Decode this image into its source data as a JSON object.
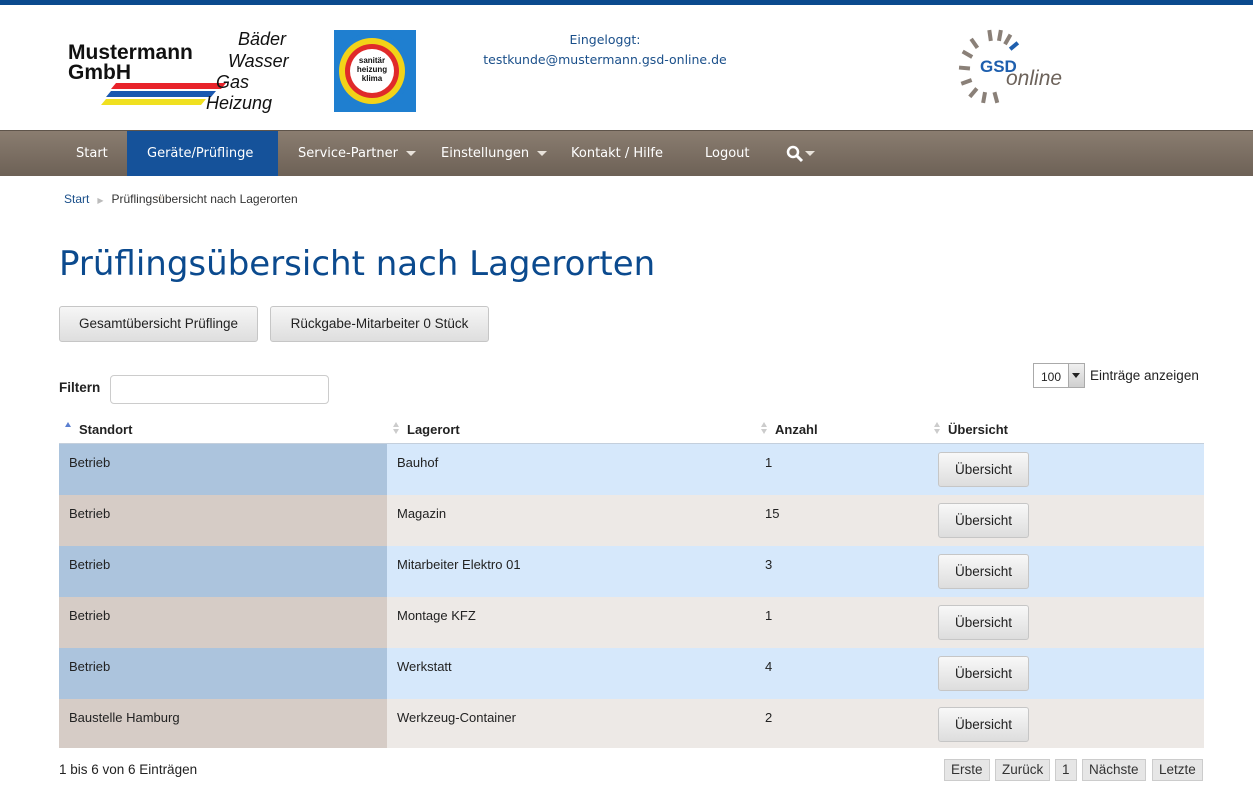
{
  "header": {
    "logo": {
      "line1": "Mustermann",
      "line2": "GmbH",
      "trades": [
        "Bäder",
        "Wasser",
        "Gas",
        "Heizung"
      ]
    },
    "badge": [
      "sanitär",
      "heizung",
      "klima"
    ],
    "login_label": "Eingeloggt:",
    "login_user": "testkunde@mustermann.gsd-online.de",
    "gsd_logo": {
      "top": "GSD",
      "bottom": "online"
    }
  },
  "nav": {
    "items": [
      {
        "label": "Start"
      },
      {
        "label": "Geräte/Prüflinge"
      },
      {
        "label": "Service-Partner"
      },
      {
        "label": "Einstellungen"
      },
      {
        "label": "Kontakt / Hilfe"
      },
      {
        "label": "Logout"
      }
    ],
    "search_icon": "search-icon"
  },
  "breadcrumb": {
    "home": "Start",
    "current": "Prüflingsübersicht nach Lagerorten"
  },
  "page": {
    "title": "Prüflingsübersicht nach Lagerorten",
    "btn_overview": "Gesamtübersicht Prüflinge",
    "btn_return": "Rückgabe-Mitarbeiter 0 Stück",
    "filter_label": "Filtern",
    "filter_value": "",
    "page_length": "100",
    "page_length_label": "Einträge anzeigen"
  },
  "table": {
    "columns": [
      "Standort",
      "Lagerort",
      "Anzahl",
      "Übersicht"
    ],
    "rows": [
      {
        "standort": "Betrieb",
        "lagerort": "Bauhof",
        "anzahl": "1",
        "button": "Übersicht"
      },
      {
        "standort": "Betrieb",
        "lagerort": "Magazin",
        "anzahl": "15",
        "button": "Übersicht"
      },
      {
        "standort": "Betrieb",
        "lagerort": "Mitarbeiter Elektro 01",
        "anzahl": "3",
        "button": "Übersicht"
      },
      {
        "standort": "Betrieb",
        "lagerort": "Montage KFZ",
        "anzahl": "1",
        "button": "Übersicht"
      },
      {
        "standort": "Betrieb",
        "lagerort": "Werkstatt",
        "anzahl": "4",
        "button": "Übersicht"
      },
      {
        "standort": "Baustelle Hamburg",
        "lagerort": "Werkzeug-Container",
        "anzahl": "2",
        "button": "Übersicht"
      }
    ],
    "info": "1 bis 6 von 6 Einträgen",
    "pagination": [
      "Erste",
      "Zurück",
      "1",
      "Nächste",
      "Letzte"
    ]
  },
  "colors": {
    "brand_blue": "#0b4a8e",
    "nav_bg": "#7a6e63",
    "nav_active": "#15529a"
  }
}
